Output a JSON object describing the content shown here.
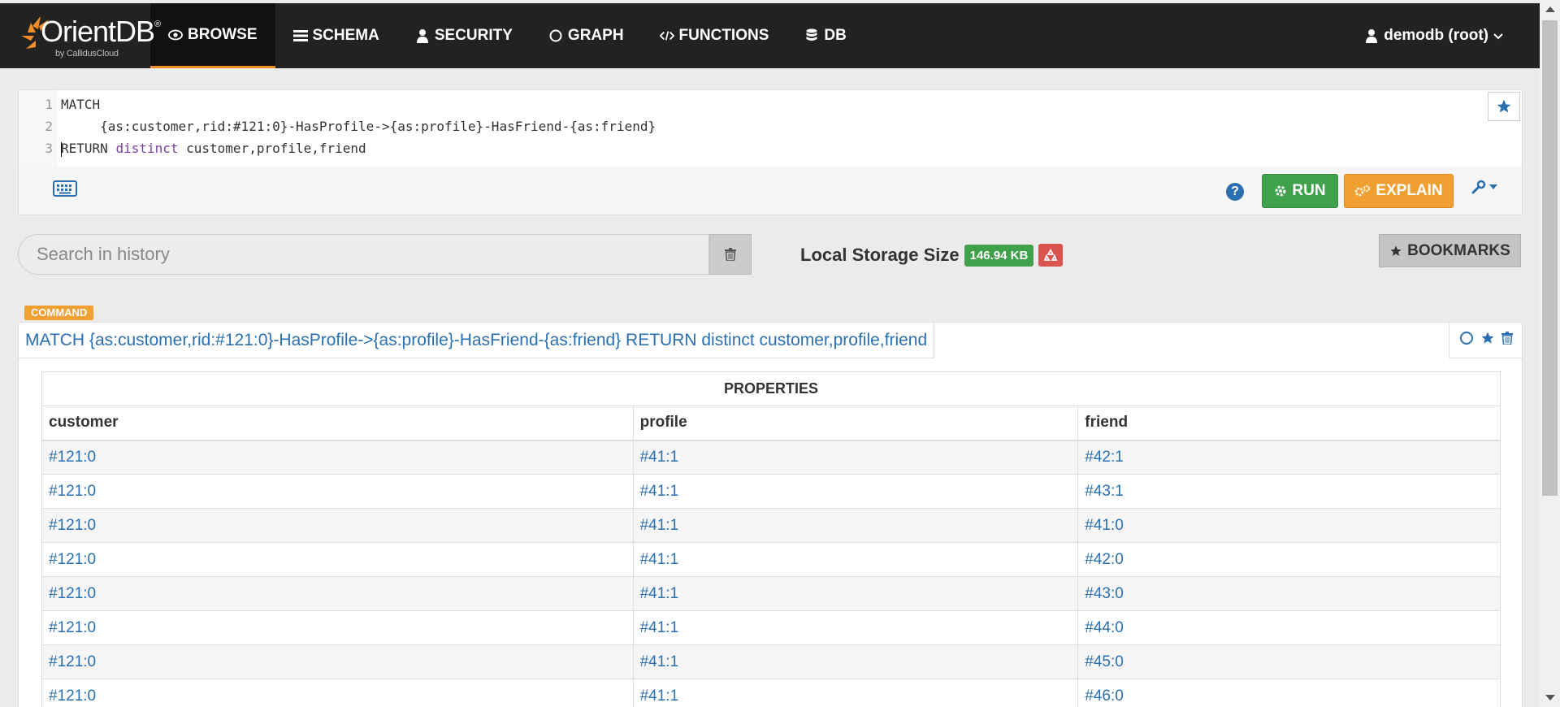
{
  "brand": {
    "name": "OrientDB",
    "reg": "®",
    "sub": "by CallidusCloud"
  },
  "nav": {
    "items": [
      {
        "label": "BROWSE",
        "icon": "eye-icon",
        "active": true
      },
      {
        "label": "SCHEMA",
        "icon": "list-icon"
      },
      {
        "label": "SECURITY",
        "icon": "user-icon"
      },
      {
        "label": "GRAPH",
        "icon": "circle-icon"
      },
      {
        "label": "FUNCTIONS",
        "icon": "code-icon"
      },
      {
        "label": "DB",
        "icon": "database-icon"
      }
    ],
    "user": "demodb (root)"
  },
  "editor": {
    "line_numbers": [
      "1",
      "2",
      "3"
    ],
    "line1": "MATCH",
    "line2": "     {as:customer,rid:#121:0}-HasProfile->{as:profile}-HasFriend-{as:friend}",
    "line3_kw": "RETURN",
    "line3_kw2": "distinct",
    "line3_rest": " customer,profile,friend"
  },
  "toolbar": {
    "help": "?",
    "run_label": "RUN",
    "explain_label": "EXPLAIN"
  },
  "history": {
    "placeholder": "Search in history",
    "storage_label": "Local Storage Size",
    "storage_value": "146.94 KB",
    "bookmarks_label": "BOOKMARKS"
  },
  "result": {
    "badge": "COMMAND",
    "query": "MATCH {as:customer,rid:#121:0}-HasProfile->{as:profile}-HasFriend-{as:friend} RETURN distinct customer,profile,friend",
    "table": {
      "caption": "PROPERTIES",
      "columns": [
        "customer",
        "profile",
        "friend"
      ],
      "rows": [
        [
          "#121:0",
          "#41:1",
          "#42:1"
        ],
        [
          "#121:0",
          "#41:1",
          "#43:1"
        ],
        [
          "#121:0",
          "#41:1",
          "#41:0"
        ],
        [
          "#121:0",
          "#41:1",
          "#42:0"
        ],
        [
          "#121:0",
          "#41:1",
          "#43:0"
        ],
        [
          "#121:0",
          "#41:1",
          "#44:0"
        ],
        [
          "#121:0",
          "#41:1",
          "#45:0"
        ],
        [
          "#121:0",
          "#41:1",
          "#46:0"
        ]
      ]
    }
  },
  "colors": {
    "navbar": "#222222",
    "accent_orange": "#f0a030",
    "run_green": "#3fa24a",
    "link_blue": "#2a6fb0"
  }
}
